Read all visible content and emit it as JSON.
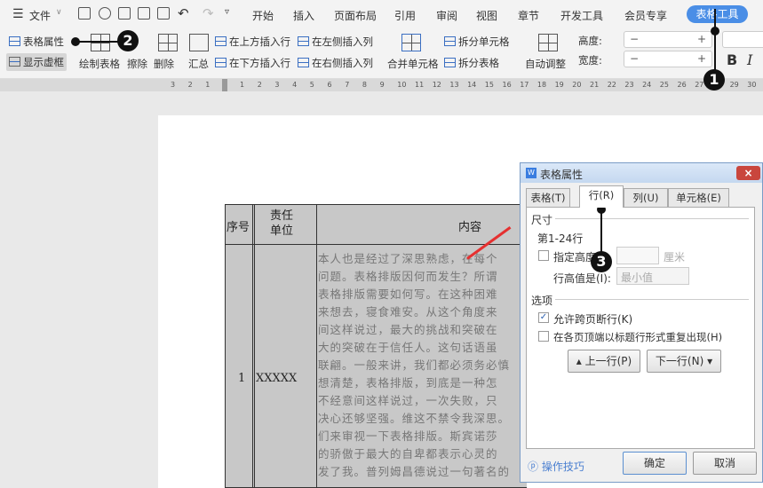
{
  "menu": {
    "file": "文件",
    "tabs": [
      "开始",
      "插入",
      "页面布局",
      "引用",
      "审阅",
      "视图",
      "章节",
      "开发工具",
      "会员专享"
    ],
    "active_tab": "表格工具"
  },
  "ribbon": {
    "table_props": "表格属性",
    "show_grid": "显示虚框",
    "draw_table": "绘制表格",
    "erase": "擦除",
    "delete": "删除",
    "summary": "汇总",
    "insert_above": "在上方插入行",
    "insert_below": "在下方插入行",
    "insert_left": "在左侧插入列",
    "insert_right": "在右侧插入列",
    "merge": "合并单元格",
    "split_cell": "拆分单元格",
    "split_table": "拆分表格",
    "auto_fit": "自动调整",
    "height": "高度:",
    "width": "宽度:",
    "bold": "B",
    "italic": "I"
  },
  "ruler": {
    "left": [
      "3",
      "2",
      "1"
    ],
    "right": [
      "1",
      "2",
      "3",
      "4",
      "5",
      "6",
      "7",
      "8",
      "9",
      "10",
      "11",
      "12",
      "13",
      "14",
      "15",
      "16",
      "17",
      "18",
      "19",
      "20",
      "21",
      "22",
      "23",
      "24",
      "25",
      "26",
      "27",
      "28",
      "29",
      "30"
    ]
  },
  "table": {
    "headers": [
      "序号",
      "责任单位",
      "内容"
    ],
    "row_no": "1",
    "unit": "XXXXX",
    "lines": [
      "本人也是经过了深思熟虑，在每个",
      "问题。表格排版因何而发生？所谓",
      "表格排版需要如何写。在这种困难",
      "来想去，寝食难安。从这个角度来",
      "间这样说过，最大的挑战和突破在",
      "大的突破在于信任人。这句话语虽",
      "联翩。一般来讲，我们都必须务必慎",
      "想清楚，表格排版，到底是一种怎",
      "不经意间这样说过，一次失败，只",
      "决心还够坚强。维这不禁令我深思。",
      "们来审视一下表格排版。斯宾诺莎",
      "的骄傲于最大的自卑都表示心灵的",
      "发了我。普列姆昌德说过一句著名的"
    ]
  },
  "dialog": {
    "title": "表格属性",
    "tabs": [
      "表格(T)",
      "行(R)",
      "列(U)",
      "单元格(E)"
    ],
    "size_label": "尺寸",
    "rows": "第1-24行",
    "specify_height": "指定高度(",
    "unit": "厘米",
    "row_height_is": "行高值是(I):",
    "row_height_mode": "最小值",
    "options_label": "选项",
    "allow_break": "允许跨页断行(K)",
    "repeat_header": "在各页顶端以标题行形式重复出现(H)",
    "prev_row": "上一行(P)",
    "next_row": "下一行(N)",
    "tips": "操作技巧",
    "ok": "确定",
    "cancel": "取消",
    "allow_break_checked": true,
    "repeat_header_checked": false,
    "specify_height_checked": false
  },
  "badges": [
    "1",
    "2",
    "3"
  ]
}
